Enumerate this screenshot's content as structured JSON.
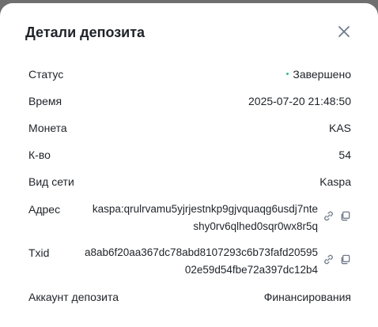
{
  "modal": {
    "title": "Детали депозита"
  },
  "rows": {
    "status": {
      "label": "Статус",
      "value": "Завершено",
      "color": "#2ebd85"
    },
    "time": {
      "label": "Время",
      "value": "2025-07-20 21:48:50"
    },
    "coin": {
      "label": "Монета",
      "value": "KAS"
    },
    "amount": {
      "label": "К-во",
      "value": "54"
    },
    "network": {
      "label": "Вид сети",
      "value": "Kaspa"
    },
    "address": {
      "label": "Адрес",
      "line1": "kaspa:qrulrvamu5yjrjestnkp9gjvquaqg6usdj7nte",
      "line2": "shy0rv6qlhed0sqr0wx8r5q"
    },
    "txid": {
      "label": "Txid",
      "line1": "a8ab6f20aa367dc78abd8107293c6b73fafd20595",
      "line2": "02e59d54fbe72a397dc12b4"
    },
    "account": {
      "label": "Аккаунт депозита",
      "value": "Финансирования"
    }
  },
  "icons": {
    "close": "close-icon",
    "link": "link-icon",
    "copy": "copy-icon"
  }
}
